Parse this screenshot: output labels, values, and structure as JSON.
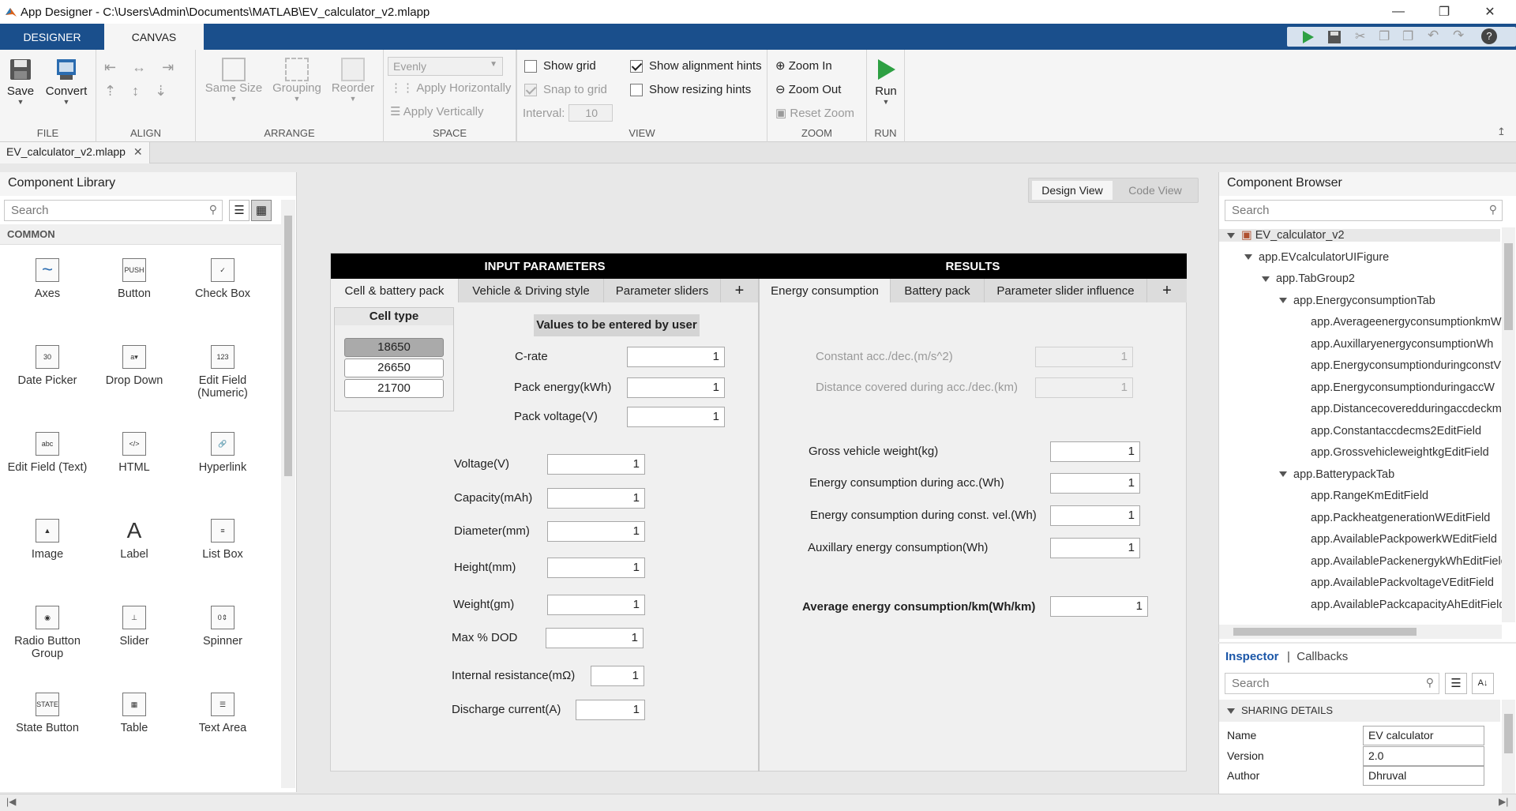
{
  "window": {
    "title": "App Designer - C:\\Users\\Admin\\Documents\\MATLAB\\EV_calculator_v2.mlapp"
  },
  "ribbon_tabs": [
    "DESIGNER",
    "CANVAS"
  ],
  "ribbon": {
    "file": {
      "label": "FILE",
      "save": "Save",
      "convert": "Convert"
    },
    "align": {
      "label": "ALIGN"
    },
    "arrange": {
      "label": "ARRANGE",
      "same_size": "Same Size",
      "grouping": "Grouping",
      "reorder": "Reorder"
    },
    "space": {
      "label": "SPACE",
      "evenly": "Evenly",
      "apply_h": "Apply Horizontally",
      "apply_v": "Apply Vertically",
      "interval_label": "Interval:",
      "interval_value": "10"
    },
    "view": {
      "label": "VIEW",
      "show_grid": "Show grid",
      "snap_to_grid": "Snap to grid",
      "show_alignment": "Show alignment hints",
      "show_resizing": "Show resizing hints"
    },
    "zoom": {
      "label": "ZOOM",
      "zoom_in": "Zoom In",
      "zoom_out": "Zoom Out",
      "reset": "Reset Zoom"
    },
    "run": {
      "label": "RUN",
      "run": "Run"
    }
  },
  "doc_tab": "EV_calculator_v2.mlapp",
  "library": {
    "title": "Component Library",
    "search_placeholder": "Search",
    "section": "COMMON",
    "components": [
      "Axes",
      "Button",
      "Check Box",
      "Date Picker",
      "Drop Down",
      "Edit Field (Numeric)",
      "Edit Field (Text)",
      "HTML",
      "Hyperlink",
      "Image",
      "Label",
      "List Box",
      "Radio Button Group",
      "Slider",
      "Spinner",
      "State Button",
      "Table",
      "Text Area"
    ]
  },
  "view_toggle": {
    "design": "Design View",
    "code": "Code View"
  },
  "app": {
    "input_header": "INPUT PARAMETERS",
    "results_header": "RESULTS",
    "input_tabs": [
      "Cell & battery pack",
      "Vehicle & Driving style",
      "Parameter sliders"
    ],
    "result_tabs": [
      "Energy consumption",
      "Battery pack",
      "Parameter slider influence"
    ],
    "add": "+",
    "cell_type": {
      "title": "Cell type",
      "options": [
        "18650",
        "26650",
        "21700"
      ],
      "selected": "18650"
    },
    "user_values_label": "Values to be entered by user",
    "fields_top": [
      {
        "label": "C-rate",
        "value": "1"
      },
      {
        "label": "Pack energy(kWh)",
        "value": "1"
      },
      {
        "label": "Pack voltage(V)",
        "value": "1"
      }
    ],
    "fields_cell": [
      {
        "label": "Voltage(V)",
        "value": "1"
      },
      {
        "label": "Capacity(mAh)",
        "value": "1"
      },
      {
        "label": "Diameter(mm)",
        "value": "1"
      },
      {
        "label": "Height(mm)",
        "value": "1"
      },
      {
        "label": "Weight(gm)",
        "value": "1"
      },
      {
        "label": "Max % DOD",
        "value": "1"
      },
      {
        "label": "Internal resistance(mΩ)",
        "value": "1"
      },
      {
        "label": "Discharge current(A)",
        "value": "1"
      }
    ],
    "results_disabled": [
      {
        "label": "Constant acc./dec.(m/s^2)",
        "value": "1"
      },
      {
        "label": "Distance covered during acc./dec.(km)",
        "value": "1"
      }
    ],
    "results": [
      {
        "label": "Gross vehicle weight(kg)",
        "value": "1"
      },
      {
        "label": "Energy consumption during acc.(Wh)",
        "value": "1"
      },
      {
        "label": "Energy consumption during const. vel.(Wh)",
        "value": "1"
      },
      {
        "label": "Auxillary energy consumption(Wh)",
        "value": "1"
      }
    ],
    "average": {
      "label": "Average energy consumption/km(Wh/km)",
      "value": "1"
    }
  },
  "browser": {
    "title": "Component Browser",
    "search_placeholder": "Search",
    "nodes": [
      "EV_calculator_v2",
      "app.EVcalculatorUIFigure",
      "app.TabGroup2",
      "app.EnergyconsumptionTab",
      "app.AverageenergyconsumptionkmW",
      "app.AuxillaryenergyconsumptionWh",
      "app.EnergyconsumptionduringconstV",
      "app.EnergyconsumptionduringaccW",
      "app.DistancecoveredduringaccdeckmE",
      "app.Constantaccdecms2EditField",
      "app.GrossvehicleweightkgEditField",
      "app.BatterypackTab",
      "app.RangeKmEditField",
      "app.PackheatgenerationWEditField",
      "app.AvailablePackpowerkWEditField",
      "app.AvailablePackenergykWhEditField",
      "app.AvailablePackvoltageVEditField",
      "app.AvailablePackcapacityAhEditField"
    ]
  },
  "inspector": {
    "tab_inspector": "Inspector",
    "tab_callbacks": "Callbacks",
    "search_placeholder": "Search",
    "section": "SHARING DETAILS",
    "rows": [
      {
        "label": "Name",
        "value": "EV calculator"
      },
      {
        "label": "Version",
        "value": "2.0"
      },
      {
        "label": "Author",
        "value": "Dhruval"
      }
    ]
  }
}
